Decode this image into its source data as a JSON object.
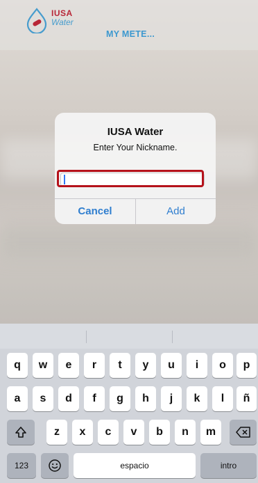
{
  "header": {
    "logo": {
      "brand": "IUSA",
      "sub": "Water"
    },
    "title": "MY METE..."
  },
  "alert": {
    "title": "IUSA Water",
    "message": "Enter Your Nickname.",
    "input_value": "",
    "cancel_label": "Cancel",
    "add_label": "Add"
  },
  "keyboard": {
    "row1": [
      "q",
      "w",
      "e",
      "r",
      "t",
      "y",
      "u",
      "i",
      "o",
      "p"
    ],
    "row2": [
      "a",
      "s",
      "d",
      "f",
      "g",
      "h",
      "j",
      "k",
      "l",
      "ñ"
    ],
    "row3": [
      "z",
      "x",
      "c",
      "v",
      "b",
      "n",
      "m"
    ],
    "numbers_label": "123",
    "space_label": "espacio",
    "return_label": "intro",
    "icons": {
      "shift": "shift-icon",
      "backspace": "backspace-icon",
      "emoji": "emoji-icon"
    }
  },
  "colors": {
    "accent": "#2f7ecf",
    "title": "#3f9fd8",
    "highlight": "#b5121b",
    "brand_red": "#c0283a"
  }
}
